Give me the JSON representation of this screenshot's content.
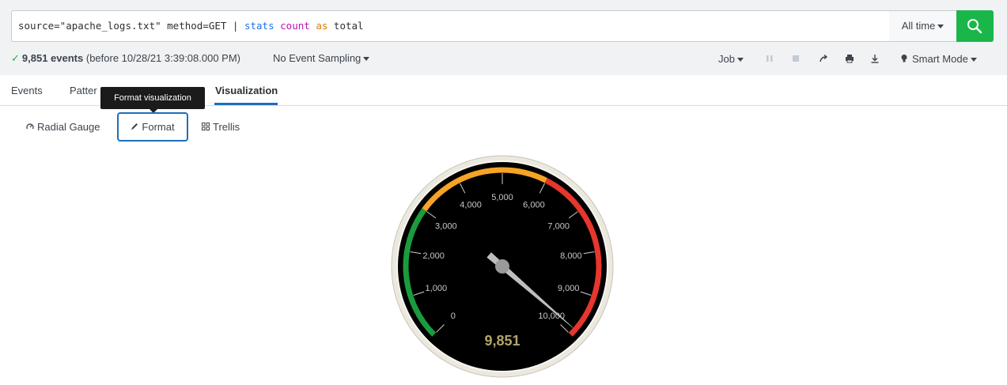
{
  "search": {
    "query_parts": {
      "p1": "source=\"apache_logs.txt\" method=GET | ",
      "p2": "stats",
      "p3": " ",
      "p4": "count",
      "p5": " ",
      "p6": "as",
      "p7": " total"
    },
    "time_range": "All time",
    "search_button_icon": "search-icon"
  },
  "status": {
    "check_icon": "✓",
    "events": "9,851 events",
    "before": "(before 10/28/21 3:39:08.000 PM)",
    "sampling": "No Event Sampling",
    "job": "Job",
    "mode": "Smart Mode"
  },
  "tabs": {
    "events": "Events",
    "patterns": "Patter",
    "visualization": "Visualization"
  },
  "tooltip": "Format visualization",
  "viz_toolbar": {
    "type": "Radial Gauge",
    "format": "Format",
    "trellis": "Trellis"
  },
  "gauge": {
    "value": 9851,
    "value_label": "9,851",
    "min": 0,
    "max": 10000,
    "tick_labels": [
      "0",
      "1,000",
      "2,000",
      "3,000",
      "4,000",
      "5,000",
      "6,000",
      "7,000",
      "8,000",
      "9,000",
      "10,000"
    ],
    "ranges": [
      {
        "from": 0,
        "to": 3000,
        "color": "#1a9c3e"
      },
      {
        "from": 3000,
        "to": 6000,
        "color": "#f6a326"
      },
      {
        "from": 6000,
        "to": 10000,
        "color": "#e7362d"
      }
    ]
  }
}
